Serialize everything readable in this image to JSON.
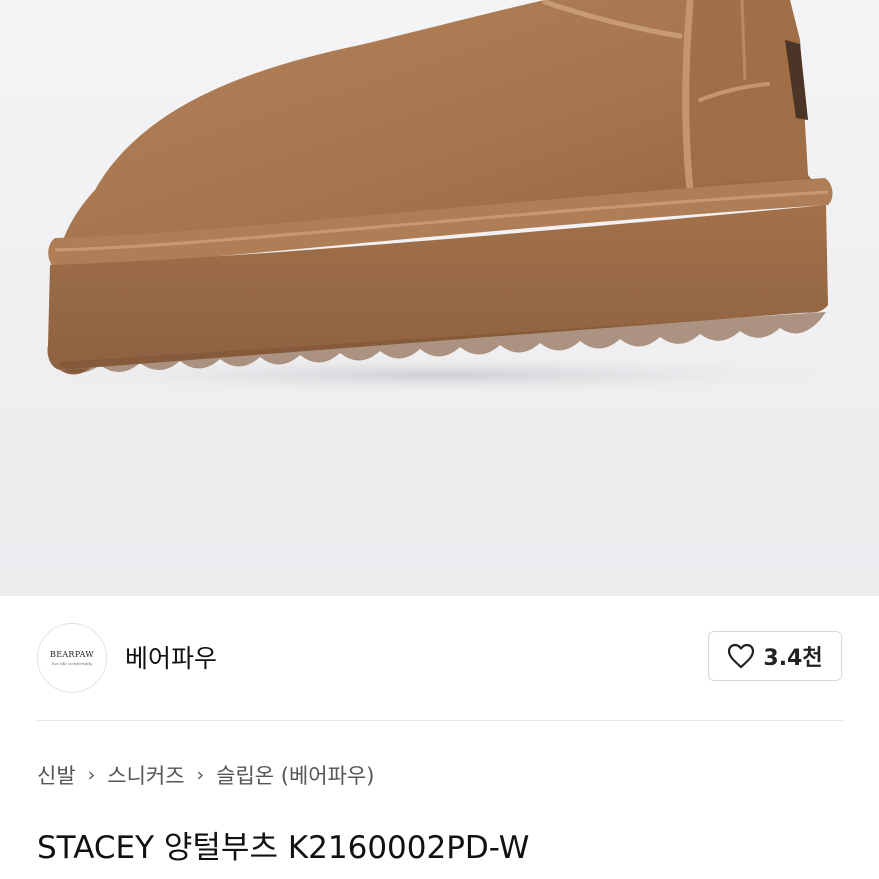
{
  "brand": {
    "name": "베어파우",
    "logo_text": "BEARPAW",
    "logo_tagline": "live life comfortably"
  },
  "like": {
    "count": "3.4천",
    "icon": "heart-outline-icon"
  },
  "breadcrumb": {
    "items": [
      "신발",
      "스니커즈",
      "슬립온 (베어파우)"
    ],
    "separator": "chevron-right-icon"
  },
  "product": {
    "title": "STACEY 양털부츠 K2160002PD-W"
  },
  "colors": {
    "boot_suede": "#a8774f",
    "sole": "#9a6a44",
    "background": "#ededf0"
  }
}
